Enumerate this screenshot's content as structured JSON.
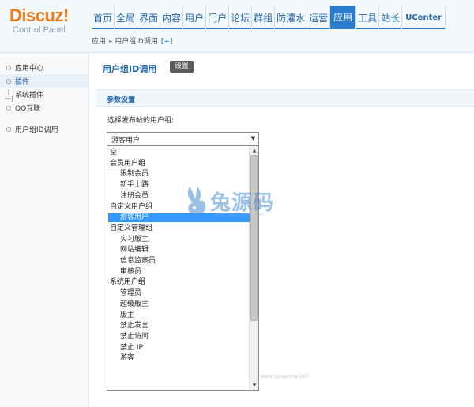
{
  "logo": {
    "main": "Discuz!",
    "sub": "Control Panel"
  },
  "nav": [
    {
      "label": "首页",
      "active": false
    },
    {
      "label": "全局",
      "active": false
    },
    {
      "label": "界面",
      "active": false
    },
    {
      "label": "内容",
      "active": false
    },
    {
      "label": "用户",
      "active": false
    },
    {
      "label": "门户",
      "active": false
    },
    {
      "label": "论坛",
      "active": false
    },
    {
      "label": "群组",
      "active": false
    },
    {
      "label": "防灌水",
      "active": false
    },
    {
      "label": "运营",
      "active": false
    },
    {
      "label": "应用",
      "active": true
    },
    {
      "label": "工具",
      "active": false
    },
    {
      "label": "站长",
      "active": false
    },
    {
      "label": "UCenter",
      "active": false
    }
  ],
  "breadcrumb": {
    "text": "应用 » 用户组ID调用",
    "plus": "[+]"
  },
  "sidebar": {
    "items": [
      {
        "label": "应用中心",
        "bullet": "○",
        "active": false
      },
      {
        "label": "插件",
        "bullet": "○",
        "active": true
      },
      {
        "label": "系统插件",
        "bullet": "|—|",
        "active": false
      },
      {
        "label": "QQ互联",
        "bullet": "○",
        "active": false
      }
    ],
    "sub_items": [
      {
        "label": "用户组ID调用",
        "bullet": "○",
        "active": false
      }
    ]
  },
  "main": {
    "title": "用户组ID调用",
    "settings_button": "设置",
    "section_title": "参数设置",
    "field_label": "选择发布帖的用户组:",
    "select_value": "游客用户",
    "select_arrow": "▼"
  },
  "dropdown": {
    "options": [
      {
        "label": "空",
        "kind": "plain"
      },
      {
        "label": "会员用户组",
        "kind": "group"
      },
      {
        "label": "限制会员",
        "kind": "child"
      },
      {
        "label": "新手上路",
        "kind": "child"
      },
      {
        "label": "注册会员",
        "kind": "child"
      },
      {
        "label": "自定义用户组",
        "kind": "group"
      },
      {
        "label": "游客用户",
        "kind": "selected"
      },
      {
        "label": "自定义管理组",
        "kind": "group"
      },
      {
        "label": "实习版主",
        "kind": "child"
      },
      {
        "label": "网站编辑",
        "kind": "child"
      },
      {
        "label": "信息监察员",
        "kind": "child"
      },
      {
        "label": "审核员",
        "kind": "child"
      },
      {
        "label": "系统用户组",
        "kind": "group"
      },
      {
        "label": "管理员",
        "kind": "child"
      },
      {
        "label": "超级版主",
        "kind": "child"
      },
      {
        "label": "版主",
        "kind": "child"
      },
      {
        "label": "禁止发言",
        "kind": "child"
      },
      {
        "label": "禁止访问",
        "kind": "child"
      },
      {
        "label": "禁止 IP",
        "kind": "child"
      },
      {
        "label": "游客",
        "kind": "child"
      }
    ],
    "scroll_up": "▲",
    "scroll_down": "▼"
  },
  "watermark": {
    "text": "兔源码",
    "url": "www.tuyuanma.com",
    "url2": "www.tuyuanma.com"
  },
  "colors": {
    "accent": "#2b7acd",
    "brand": "#f27d18",
    "selected": "#3399ff"
  }
}
